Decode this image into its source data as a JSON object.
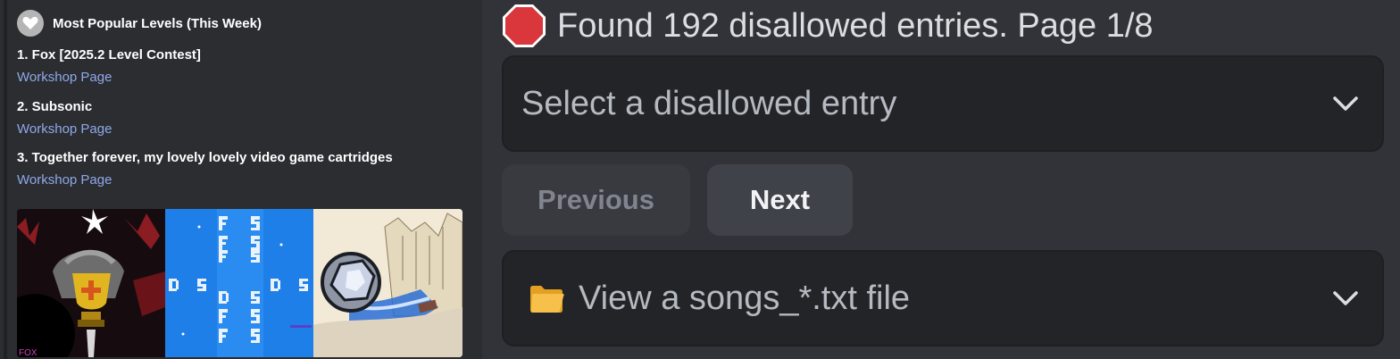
{
  "embed": {
    "header": "Most Popular Levels (This Week)",
    "entries": [
      {
        "title": "1. Fox [2025.2 Level Contest]",
        "link": "Workshop Page"
      },
      {
        "title": "2. Subsonic",
        "link": "Workshop Page"
      },
      {
        "title": "3. Together forever, my lovely lovely video game cartridges",
        "link": "Workshop Page"
      }
    ],
    "image_caption": "FOX"
  },
  "message": {
    "status_text": "Found 192 disallowed entries. Page 1/8",
    "select_entry_placeholder": "Select a disallowed entry",
    "previous_label": "Previous",
    "next_label": "Next",
    "select_file_placeholder": "View a songs_*.txt file"
  },
  "colors": {
    "link": "#8fa8e8",
    "stop_sign": "#da373c",
    "disabled_button": "#383a40",
    "active_button": "#404249"
  },
  "icons": {
    "author": "heart-icon",
    "status": "stop-sign-icon",
    "dropdown": "chevron-down-icon",
    "file": "folder-icon"
  }
}
